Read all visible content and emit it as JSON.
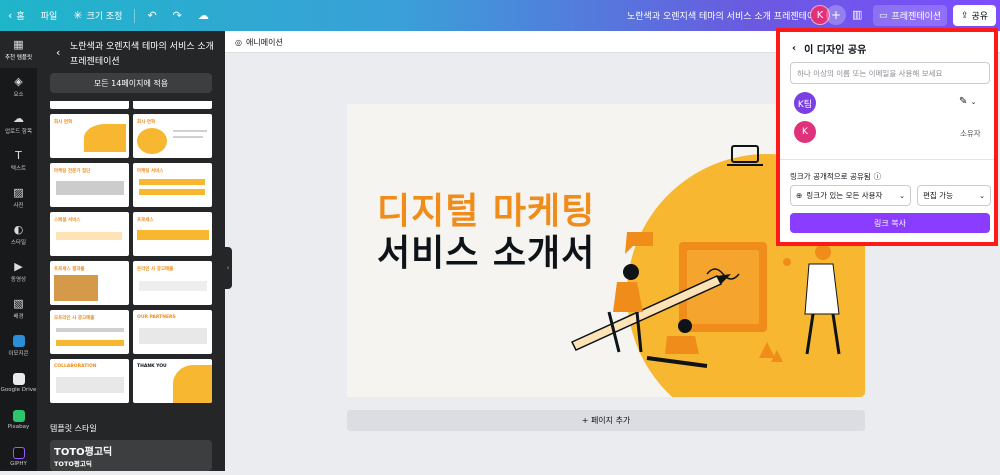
{
  "topbar": {
    "home": "홈",
    "file": "파일",
    "resize": "크기 조정",
    "doc_title": "노란색과 오렌지색 테마의 서비스 소개 프레젠테이션",
    "avatar": "K",
    "present": "프레젠테이션",
    "share": "공유"
  },
  "rail": [
    {
      "label": "추천 템플릿",
      "icon": "template-icon"
    },
    {
      "label": "요소",
      "icon": "elements-icon"
    },
    {
      "label": "업로드 항목",
      "icon": "upload-icon"
    },
    {
      "label": "텍스트",
      "icon": "text-icon"
    },
    {
      "label": "사진",
      "icon": "photo-icon"
    },
    {
      "label": "스타일",
      "icon": "style-icon"
    },
    {
      "label": "동영상",
      "icon": "video-icon"
    },
    {
      "label": "배경",
      "icon": "background-icon"
    },
    {
      "label": "이모지콘",
      "icon": "emoji-icon"
    },
    {
      "label": "Google Drive",
      "icon": "google-drive-icon"
    },
    {
      "label": "Pixabay",
      "icon": "pixabay-icon"
    },
    {
      "label": "GIPHY",
      "icon": "giphy-icon"
    }
  ],
  "panel": {
    "title": "노란색과 오렌지색 테마의 서비스 소개 프레젠테이션",
    "apply_all": "모든 14페이지에 적용",
    "thumbs": [
      {
        "title": "회사 연혁"
      },
      {
        "title": "회사 연혁"
      },
      {
        "title": "마케팅 전문가 집단"
      },
      {
        "title": "마케팅 서비스"
      },
      {
        "title": "스페셜 서비스"
      },
      {
        "title": "프로세스"
      },
      {
        "title": "프로세스 결과물"
      },
      {
        "title": "온라인 사 광고매출"
      },
      {
        "title": "오프라인 사 광고매출"
      },
      {
        "title": "OUR PARTNERS"
      },
      {
        "title": "COLLABORATION"
      },
      {
        "title": "THANK YOU"
      }
    ],
    "styles_label": "템플릿 스타일",
    "font_big": "TOTO평고딕",
    "font_small": "TOTO평고딕"
  },
  "canvas": {
    "animation": "애니메이션",
    "slide_line1": "디지털 마케팅",
    "slide_line2": "서비스 소개서",
    "add_page": "+ 페이지 추가"
  },
  "share_popup": {
    "title": "이 디자인 공유",
    "input_placeholder": "하나 이상의 이름 또는 이메일을 사용해 보세요",
    "team_avatar": "K팀",
    "user_avatar": "K",
    "owner_label": "소유자",
    "link_label": "링크가 공개적으로 공유됨",
    "link_access": "링크가 있는 모든 사용자",
    "permission": "편집 가능",
    "copy_link": "링크 복사"
  },
  "colors": {
    "accent": "#8b3dff",
    "highlight_border": "#ff1a1a",
    "slide_orange": "#f08c1a",
    "slide_yellow": "#f7b731"
  }
}
